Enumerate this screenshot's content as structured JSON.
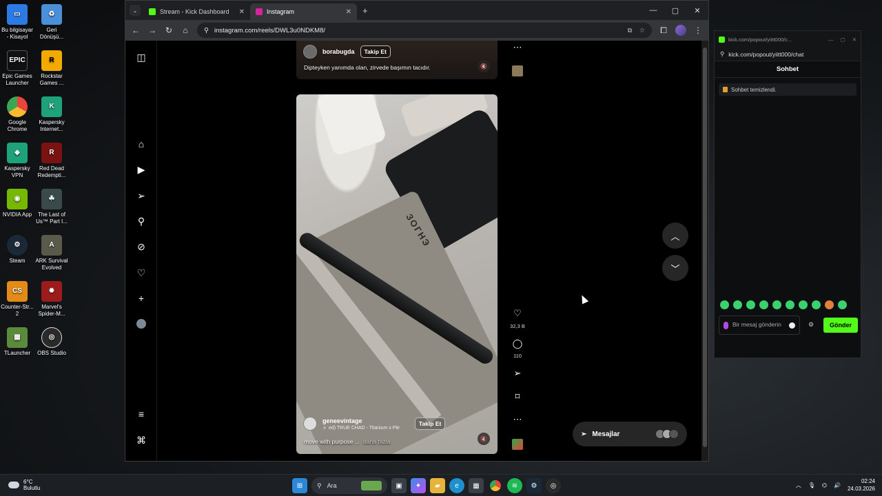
{
  "desktop": {
    "icons": [
      {
        "label": "Bu bilgisayar - Kisayol",
        "color": "#2c7be5"
      },
      {
        "label": "Geri Dönüşü...",
        "color": "#4a90d9"
      },
      {
        "label": "Epic Games Launcher",
        "color": "#111111"
      },
      {
        "label": "Rockstar Games ...",
        "color": "#f2a900"
      },
      {
        "label": "Google Chrome",
        "color": "#e8453c"
      },
      {
        "label": "Kaspersky Internet...",
        "color": "#1ea27a"
      },
      {
        "label": "Kaspersky VPN",
        "color": "#1ea27a"
      },
      {
        "label": "Red Dead Redempti...",
        "color": "#7a1212"
      },
      {
        "label": "NVIDIA App",
        "color": "#76b900"
      },
      {
        "label": "The Last of Us™ Part I...",
        "color": "#3a4a4a"
      },
      {
        "label": "Steam",
        "color": "#1b2838"
      },
      {
        "label": "ARK Survival Evolved",
        "color": "#5a5a4a"
      },
      {
        "label": "Counter-Str... 2",
        "color": "#e38b16"
      },
      {
        "label": "Marvel's Spider-M...",
        "color": "#9d1b1b"
      },
      {
        "label": "TLauncher",
        "color": "#5a8a3a"
      },
      {
        "label": "OBS Studio",
        "color": "#2a2a2a"
      }
    ]
  },
  "browser": {
    "tabs": [
      {
        "title": "Stream - Kick Dashboard",
        "favicon_color": "#53fc18"
      },
      {
        "title": "Instagram",
        "favicon_color": "#d6249f"
      }
    ],
    "address": "instagram.com/reels/DWL3u0NDKM8/"
  },
  "instagram": {
    "top_reel": {
      "username": "borabugda",
      "follow": "Takip Et",
      "caption": "Dipteyken yanımda olan, zirvede başımın tacıdır."
    },
    "main_reel": {
      "username": "geneevintage",
      "audio": "♬ ed)  TRUE CHAD - Titanium x Ple",
      "follow": "Takip Et",
      "caption": "move with purpose ...",
      "more": "daha fazla",
      "notebook_text": "ЗОГНЭ"
    },
    "likes": "32,3 B",
    "comments": "110",
    "messages_label": "Mesajlar"
  },
  "kick": {
    "window_title": "kick.com/popout/yiitt000/c...",
    "url": "kick.com/popout/yiitt000/chat",
    "heading": "Sohbet",
    "system_msg": "Sohbet temizlendi.",
    "input_placeholder": "Bir mesaj gönderin",
    "send": "Gönder"
  },
  "taskbar": {
    "temp": "6°C",
    "weather": "Bulutlu",
    "search": "Ara",
    "time": "02:24",
    "date": "24.03.2026"
  }
}
